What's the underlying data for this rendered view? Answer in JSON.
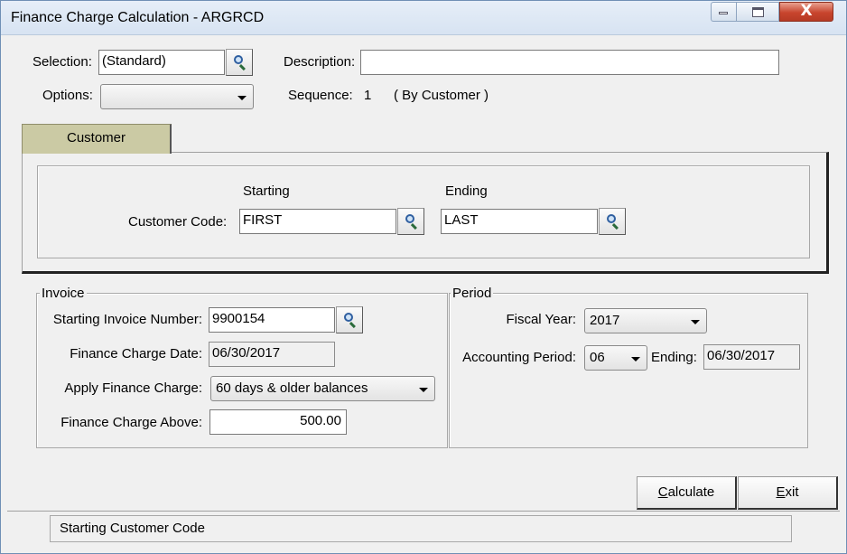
{
  "window": {
    "title": "Finance Charge Calculation - ARGRCD",
    "close_glyph": "X"
  },
  "header": {
    "selection_label": "Selection:",
    "selection_value": "(Standard)",
    "description_label": "Description:",
    "description_value": "",
    "options_label": "Options:",
    "options_value": "",
    "sequence_label": "Sequence:",
    "sequence_value": "1",
    "sequence_note": "( By Customer )"
  },
  "tab": {
    "label": "Customer",
    "starting_header": "Starting",
    "ending_header": "Ending",
    "customer_code_label": "Customer Code:",
    "starting_value": "FIRST",
    "ending_value": "LAST"
  },
  "invoice": {
    "legend": "Invoice",
    "starting_invoice_label": "Starting Invoice Number:",
    "starting_invoice_value": "9900154",
    "charge_date_label": "Finance Charge Date:",
    "charge_date_value": "06/30/2017",
    "apply_label": "Apply Finance Charge:",
    "apply_value": "60 days  & older balances",
    "above_label": "Finance Charge Above:",
    "above_value": "500.00"
  },
  "period": {
    "legend": "Period",
    "fiscal_year_label": "Fiscal Year:",
    "fiscal_year_value": "2017",
    "accounting_period_label": "Accounting Period:",
    "accounting_period_value": "06",
    "ending_label": "Ending:",
    "ending_value": "06/30/2017"
  },
  "buttons": {
    "calculate_first": "C",
    "calculate_rest": "alculate",
    "exit_first": "E",
    "exit_rest": "xit"
  },
  "status": {
    "text": "Starting Customer Code"
  },
  "icons": {
    "lookup": "magnifier-icon",
    "dropdown": "chevron-down-icon"
  }
}
